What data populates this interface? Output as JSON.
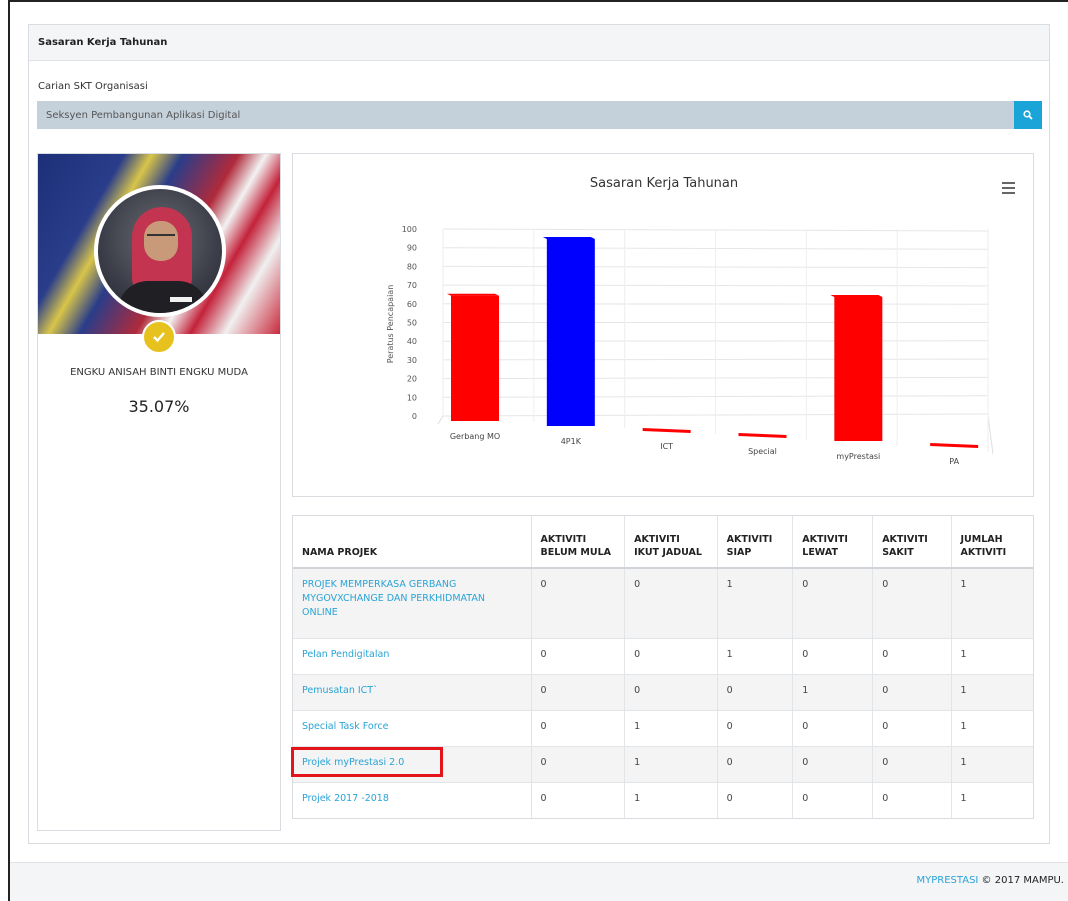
{
  "panel": {
    "title": "Sasaran Kerja Tahunan",
    "search_label": "Carian SKT Organisasi",
    "search_value": "Seksyen Pembangunan Aplikasi Digital"
  },
  "profile": {
    "name": "ENGKU ANISAH BINTI ENGKU MUDA",
    "percent": "35.07%"
  },
  "chart_data": {
    "type": "bar",
    "title": "Sasaran Kerja Tahunan",
    "ylabel": "Peratus Pencapaian",
    "xlabel": "",
    "ylim": [
      0,
      100
    ],
    "yticks": [
      "0",
      "10",
      "20",
      "30",
      "40",
      "50",
      "60",
      "70",
      "80",
      "90",
      "100"
    ],
    "categories": [
      "Gerbang MO",
      "4P1K",
      "ICT",
      "Special",
      "myPrestasi",
      "PA"
    ],
    "values": [
      67,
      100,
      0,
      0,
      77,
      0
    ],
    "colors": [
      "#ff0000",
      "#0000ff",
      "#ff0000",
      "#ff0000",
      "#ff0000",
      "#ff0000"
    ],
    "grid": true,
    "style": "3d"
  },
  "table": {
    "headers": [
      "NAMA PROJEK",
      "AKTIVITI BELUM MULA",
      "AKTIVITI IKUT JADUAL",
      "AKTIVITI SIAP",
      "AKTIVITI LEWAT",
      "AKTIVITI SAKIT",
      "JUMLAH AKTIVITI"
    ],
    "rows": [
      [
        "PROJEK MEMPERKASA GERBANG MYGOVXCHANGE DAN PERKHIDMATAN ONLINE",
        "0",
        "0",
        "1",
        "0",
        "0",
        "1"
      ],
      [
        "Pelan Pendigitalan",
        "0",
        "0",
        "1",
        "0",
        "0",
        "1"
      ],
      [
        "Pemusatan ICT`",
        "0",
        "0",
        "0",
        "1",
        "0",
        "1"
      ],
      [
        "Special Task Force",
        "0",
        "1",
        "0",
        "0",
        "0",
        "1"
      ],
      [
        "Projek myPrestasi 2.0",
        "0",
        "1",
        "0",
        "0",
        "0",
        "1"
      ],
      [
        "Projek 2017 -2018",
        "0",
        "1",
        "0",
        "0",
        "0",
        "1"
      ]
    ]
  },
  "footer": {
    "brand": "MYPRESTASI",
    "copyright": " © 2017 MAMPU."
  }
}
